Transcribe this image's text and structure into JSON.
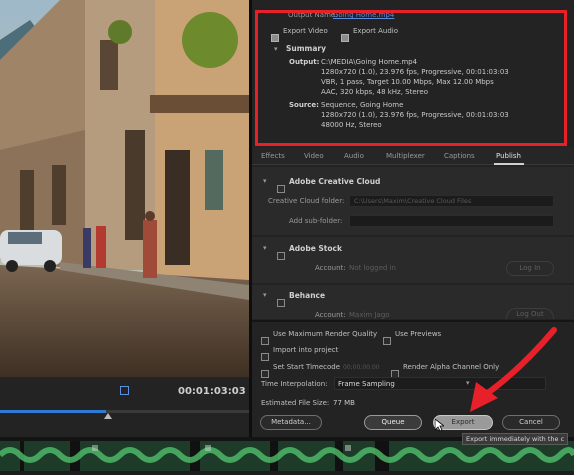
{
  "output": {
    "name_label": "Output Name:",
    "name_value": "Going Home.mp4",
    "export_video_label": "Export Video",
    "export_audio_label": "Export Audio"
  },
  "summary": {
    "title": "Summary",
    "output_label": "Output:",
    "output_lines": [
      "C:\\MEDIA\\Going Home.mp4",
      "1280x720 (1.0), 23.976 fps, Progressive, 00:01:03:03",
      "VBR, 1 pass, Target 10.00 Mbps, Max 12.00 Mbps",
      "AAC, 320 kbps, 48 kHz, Stereo"
    ],
    "source_label": "Source:",
    "source_lines": [
      "Sequence, Going Home",
      "1280x720 (1.0), 23.976 fps, Progressive, 00:01:03:03",
      "48000 Hz, Stereo"
    ]
  },
  "tabs": [
    "Effects",
    "Video",
    "Audio",
    "Multiplexer",
    "Captions",
    "Publish"
  ],
  "active_tab": "Publish",
  "creative_cloud": {
    "title": "Adobe Creative Cloud",
    "folder_label": "Creative Cloud folder:",
    "folder_value": "C:\\Users\\Maxim\\Creative Cloud Files",
    "subfolder_label": "Add sub-folder:"
  },
  "stock": {
    "title": "Adobe Stock",
    "account_label": "Account:",
    "account_value": "Not logged in",
    "login_label": "Log In"
  },
  "behance": {
    "title": "Behance",
    "account_label": "Account:",
    "account_value": "Maxim Jago",
    "logout_label": "Log Out"
  },
  "options": {
    "max_render_quality": "Use Maximum Render Quality",
    "use_previews": "Use Previews",
    "import_into_project": "Import into project",
    "set_start_timecode": "Set Start Timecode",
    "start_timecode_value": "00;00;00;00",
    "render_alpha": "Render Alpha Channel Only",
    "time_interp_label": "Time Interpolation:",
    "time_interp_value": "Frame Sampling",
    "file_size_label": "Estimated File Size:",
    "file_size_value": "77 MB"
  },
  "buttons": {
    "metadata": "Metadata...",
    "queue": "Queue",
    "export": "Export",
    "cancel": "Cancel"
  },
  "tooltip": "Export immediately with the c",
  "player": {
    "timecode": "00:01:03:03"
  },
  "colors": {
    "highlight_box": "#e8202a",
    "arrow": "#e8202a",
    "link": "#5a8ad8",
    "progress": "#2d7bd6",
    "waveform": "#3f9a55"
  }
}
